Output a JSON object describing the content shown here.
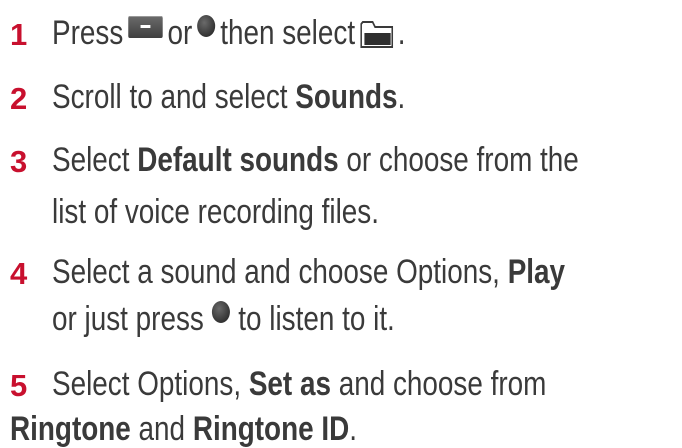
{
  "steps": [
    {
      "number": "1",
      "parts": {
        "press": "Press",
        "or": "or",
        "then_select": "then select",
        "end": "."
      },
      "icons": [
        "softkey-icon",
        "ok-button-icon",
        "folder-icon"
      ]
    },
    {
      "number": "2",
      "parts": {
        "pre": "Scroll to and select",
        "bold": "Sounds",
        "end": "."
      }
    },
    {
      "number": "3",
      "parts": {
        "pre": "Select",
        "bold": "Default sounds",
        "post": "or choose from the",
        "line2": "list of voice recording files."
      }
    },
    {
      "number": "4",
      "parts": {
        "pre": "Select a sound and choose Options,",
        "bold": "Play",
        "line2_pre": "or just press",
        "line2_post": "to listen to it."
      },
      "icons": [
        "ok-button-icon"
      ]
    },
    {
      "number": "5",
      "parts": {
        "pre": "Select Options,",
        "bold": "Set as",
        "post": "and choose from",
        "line2_bold1": "Ringtone",
        "line2_mid": "and",
        "line2_bold2": "Ringtone ID",
        "line2_end": "."
      }
    }
  ],
  "colors": {
    "step_number": "#c8102e",
    "text": "#3a3a3a"
  }
}
